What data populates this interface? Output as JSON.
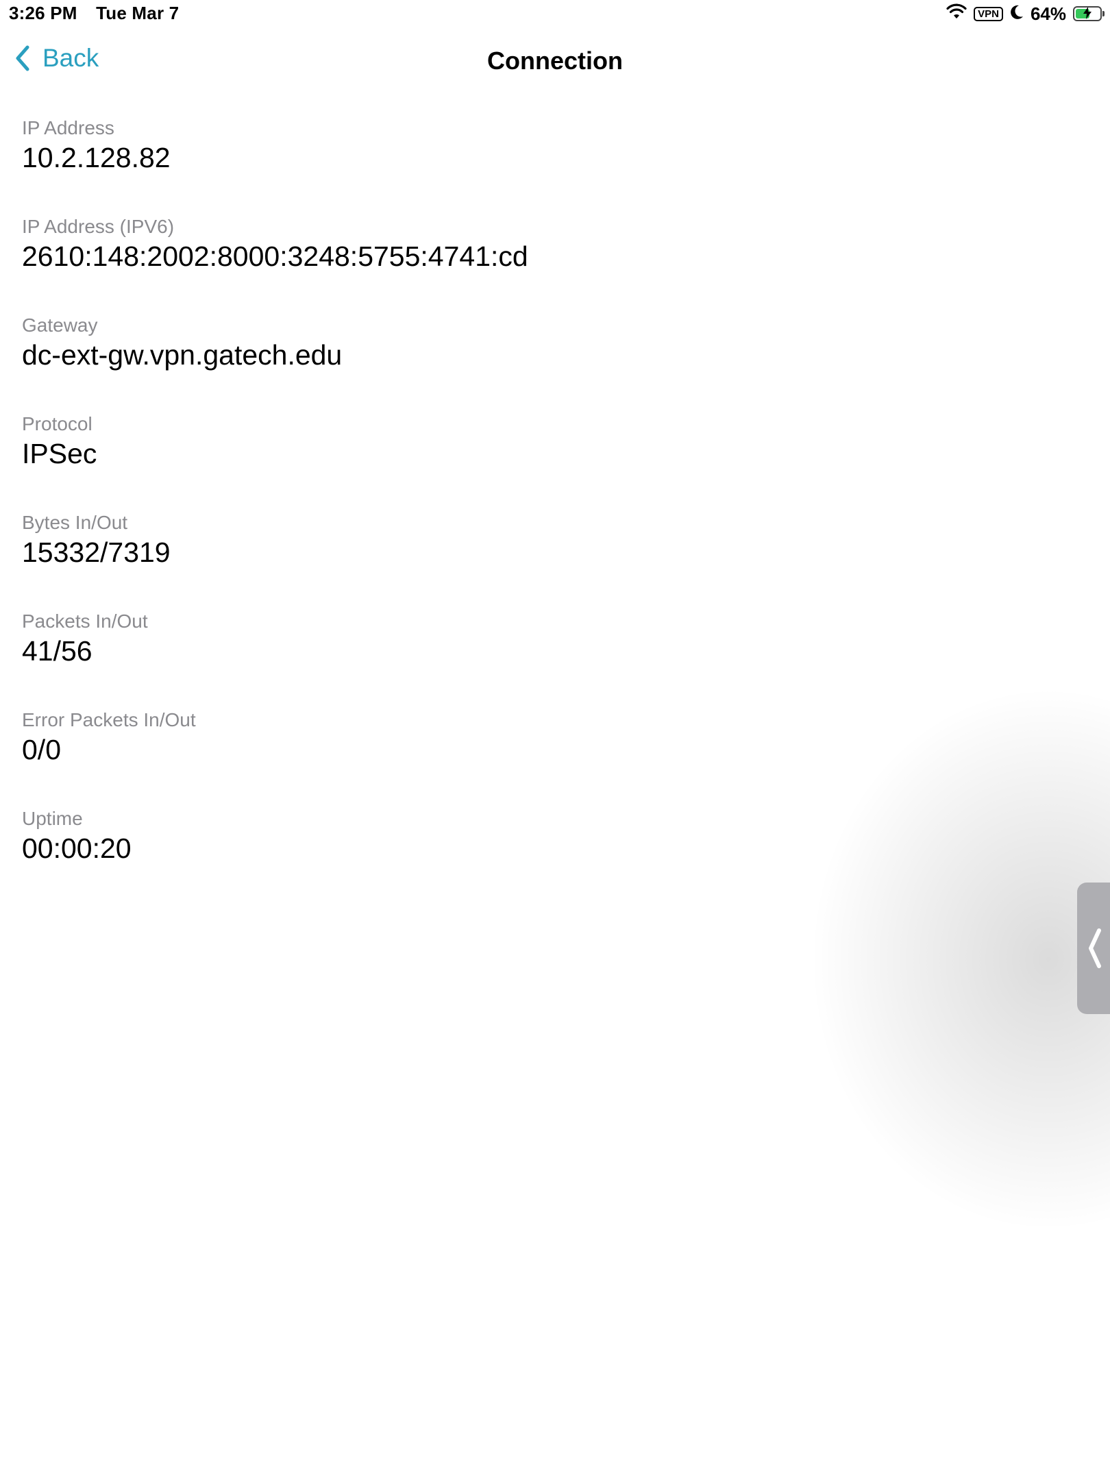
{
  "status_bar": {
    "time": "3:26 PM",
    "date": "Tue Mar 7",
    "vpn_label": "VPN",
    "battery_percent": "64%",
    "battery_level": 0.64,
    "icons": [
      "wifi-icon",
      "vpn-icon",
      "moon-icon",
      "battery-charging-icon"
    ]
  },
  "nav": {
    "back_label": "Back",
    "title": "Connection"
  },
  "details": [
    {
      "label": "IP Address",
      "value": "10.2.128.82"
    },
    {
      "label": "IP Address (IPV6)",
      "value": "2610:148:2002:8000:3248:5755:4741:cd"
    },
    {
      "label": "Gateway",
      "value": "dc-ext-gw.vpn.gatech.edu"
    },
    {
      "label": "Protocol",
      "value": "IPSec"
    },
    {
      "label": "Bytes In/Out",
      "value": "15332/7319"
    },
    {
      "label": "Packets In/Out",
      "value": "41/56"
    },
    {
      "label": "Error Packets In/Out",
      "value": "0/0"
    },
    {
      "label": "Uptime",
      "value": "00:00:20"
    }
  ],
  "colors": {
    "accent": "#2a9fbf",
    "label_gray": "#8a8a8e",
    "battery_green": "#34c759",
    "drawer_tab": "#aeaeb2"
  }
}
